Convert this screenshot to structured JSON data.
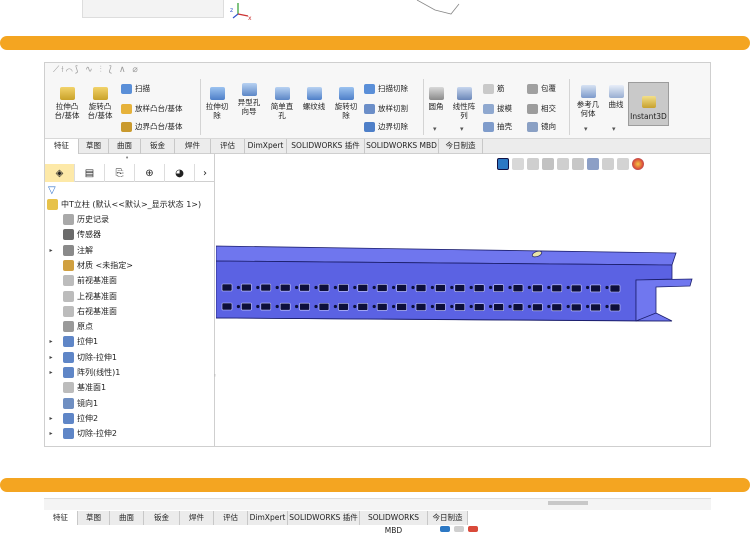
{
  "command_manager": {
    "extrude_boss": "拉伸凸\n台/基体",
    "revolve_boss": "旋转凸\n台/基体",
    "sweep": "扫描",
    "loft_boss": "放样凸台/基体",
    "boundary_boss": "边界凸台/基体",
    "extrude_cut": "拉伸切\n除",
    "hole_wizard": "异型孔\n向导",
    "simple_hole": "简单直\n孔",
    "thread": "螺纹线",
    "revolve_cut": "旋转切\n除",
    "swept_cut": "扫描切除",
    "lofted_cut": "放样切割",
    "boundary_cut": "边界切除",
    "fillet": "圆角",
    "linear_pattern": "线性阵\n列",
    "rib": "筋",
    "draft": "拔模",
    "shell": "抽壳",
    "wrap": "包覆",
    "intersect": "相交",
    "mirror": "镜向",
    "reference_geometry": "参考几\n何体",
    "curves": "曲线",
    "instant3d": "Instant3D"
  },
  "tabs": [
    "特征",
    "草图",
    "曲面",
    "钣金",
    "焊件",
    "评估",
    "DimXpert",
    "SOLIDWORKS 插件",
    "SOLIDWORKS MBD",
    "今日制造"
  ],
  "active_tab": "特征",
  "feature_tree": {
    "root": "中T立柱 (默认<<默认>_显示状态 1>)",
    "items": [
      {
        "label": "历史记录",
        "expandable": false
      },
      {
        "label": "传感器",
        "expandable": false
      },
      {
        "label": "注解",
        "expandable": true
      },
      {
        "label": "材质 <未指定>",
        "expandable": false
      },
      {
        "label": "前视基准面",
        "expandable": false
      },
      {
        "label": "上视基准面",
        "expandable": false
      },
      {
        "label": "右视基准面",
        "expandable": false
      },
      {
        "label": "原点",
        "expandable": false
      },
      {
        "label": "拉伸1",
        "expandable": true
      },
      {
        "label": "切除-拉伸1",
        "expandable": true
      },
      {
        "label": "阵列(线性)1",
        "expandable": true
      },
      {
        "label": "基准面1",
        "expandable": false
      },
      {
        "label": "镜向1",
        "expandable": false
      },
      {
        "label": "拉伸2",
        "expandable": true
      },
      {
        "label": "切除-拉伸2",
        "expandable": true
      }
    ]
  },
  "colors": {
    "orange_divider": "#f4a521",
    "part_blue": "#6f76ee",
    "part_dark": "#2a2f8a",
    "active_fm_tab": "#fde9a8"
  },
  "bottom_tabs": [
    "特征",
    "草图",
    "曲面",
    "钣金",
    "焊件",
    "评估",
    "DimXpert",
    "SOLIDWORKS 插件",
    "SOLIDWORKS MBD",
    "今日制造"
  ]
}
